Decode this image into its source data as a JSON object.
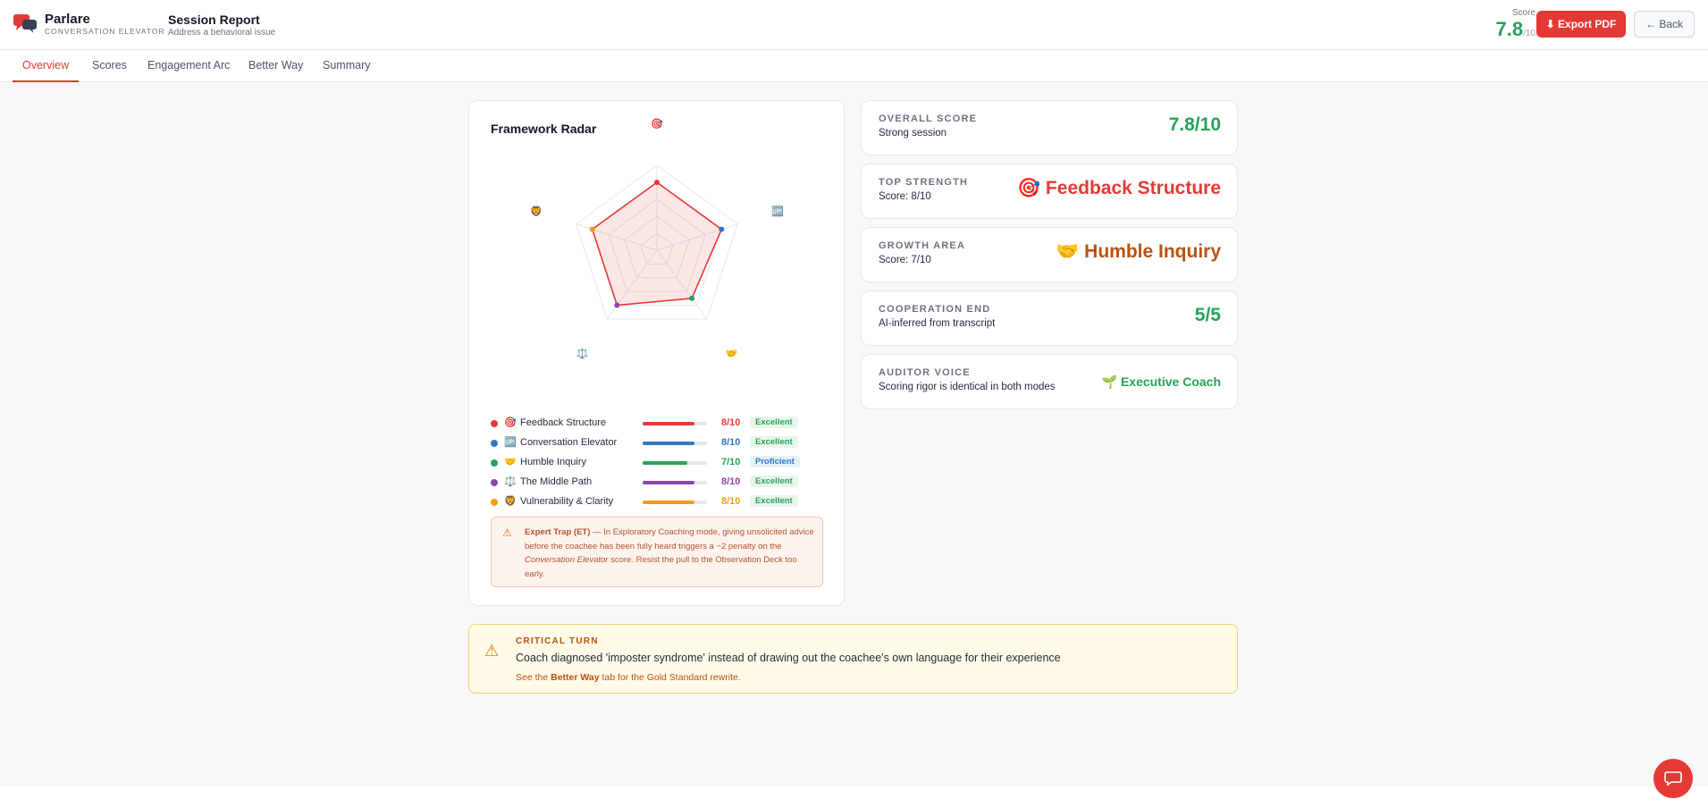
{
  "header": {
    "brand_name": "Parlare",
    "brand_sub": "CONVERSATION ELEVATOR",
    "page_title": "Session Report",
    "page_subtitle": "Address a behavioral issue",
    "score_label": "Score",
    "score_value": "7.8",
    "score_denominator": "/10",
    "export_label": "⬇ Export PDF",
    "back_label": "← Back",
    "accent_color": "#e53935"
  },
  "tabs": [
    {
      "label": "Overview",
      "active": true
    },
    {
      "label": "Scores",
      "active": false
    },
    {
      "label": "Engagement Arc",
      "active": false
    },
    {
      "label": "Better Way",
      "active": false
    },
    {
      "label": "Summary",
      "active": false
    }
  ],
  "radar": {
    "title": "Framework Radar",
    "max": 10,
    "grid_levels": 5,
    "axis_icons": [
      "🎯",
      "🆙",
      "🤝",
      "⚖️",
      "🦁"
    ]
  },
  "frameworks": [
    {
      "name": "Feedback Structure",
      "icon": "🎯",
      "score": 8,
      "score_text": "8/10",
      "level": "Excellent",
      "level_class": "excellent",
      "color": "#e53935"
    },
    {
      "name": "Conversation Elevator",
      "icon": "🆙",
      "score": 8,
      "score_text": "8/10",
      "level": "Excellent",
      "level_class": "excellent",
      "color": "#2e78c2"
    },
    {
      "name": "Humble Inquiry",
      "icon": "🤝",
      "score": 7,
      "score_text": "7/10",
      "level": "Proficient",
      "level_class": "proficient",
      "color": "#27a25a"
    },
    {
      "name": "The Middle Path",
      "icon": "⚖️",
      "score": 8,
      "score_text": "8/10",
      "level": "Excellent",
      "level_class": "excellent",
      "color": "#8e44ad"
    },
    {
      "name": "Vulnerability & Clarity",
      "icon": "🦁",
      "score": 8,
      "score_text": "8/10",
      "level": "Excellent",
      "level_class": "excellent",
      "color": "#f39c12"
    }
  ],
  "expert_trap": {
    "icon": "⚠",
    "title": "Expert Trap (ET)",
    "text_1": " — In Exploratory Coaching mode, giving unsolicited advice before the coachee has been fully heard triggers a −2 penalty on the ",
    "emphasis": "Conversation Elevator",
    "text_2": " score. Resist the pull to the Observation Deck too early."
  },
  "stats": {
    "overall": {
      "label": "OVERALL SCORE",
      "sub": "Strong session",
      "value": "7.8/10"
    },
    "strength": {
      "label": "TOP STRENGTH",
      "sub": "Score: 8/10",
      "value": "🎯 Feedback Structure"
    },
    "growth": {
      "label": "GROWTH AREA",
      "sub": "Score: 7/10",
      "value": "🤝 Humble Inquiry"
    },
    "cooperation": {
      "label": "COOPERATION END",
      "sub": "AI-inferred from transcript",
      "value": "5/5"
    },
    "auditor": {
      "label": "AUDITOR VOICE",
      "sub": "Scoring rigor is identical in both modes",
      "value": "🌱 Executive Coach"
    }
  },
  "critical_turn": {
    "icon": "⚠",
    "label": "CRITICAL TURN",
    "text": "Coach diagnosed 'imposter syndrome' instead of drawing out the coachee's own language for their experience",
    "note_prefix": "See the ",
    "note_link": "Better Way",
    "note_suffix": " tab for the Gold Standard rewrite."
  },
  "chat": {
    "icon": "chat-bubble-icon"
  }
}
